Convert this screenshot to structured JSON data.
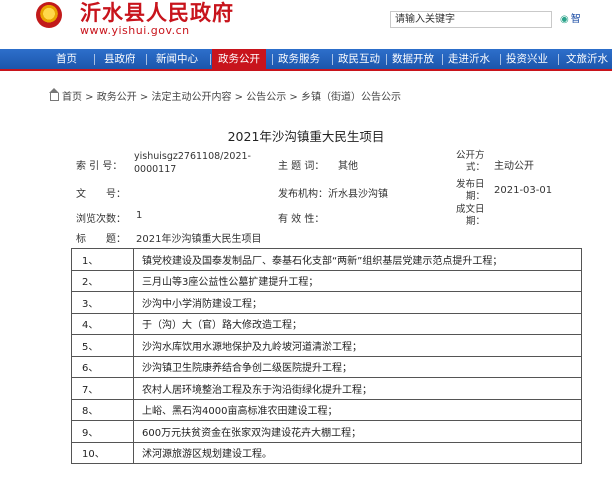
{
  "header": {
    "site_title": "沂水县人民政府",
    "site_url": "www.yishui.gov.cn",
    "search_placeholder": "请输入关键字",
    "search_button": "智"
  },
  "nav": {
    "items": [
      {
        "label": "首页",
        "active": false
      },
      {
        "label": "县政府",
        "active": false
      },
      {
        "label": "新闻中心",
        "active": false
      },
      {
        "label": "政务公开",
        "active": true
      },
      {
        "label": "政务服务",
        "active": false
      },
      {
        "label": "政民互动",
        "active": false
      },
      {
        "label": "数据开放",
        "active": false
      },
      {
        "label": "走进沂水",
        "active": false
      },
      {
        "label": "投资兴业",
        "active": false
      },
      {
        "label": "文旅沂水",
        "active": false
      }
    ]
  },
  "breadcrumb": {
    "text": "首页 > 政务公开 > 法定主动公开内容 > 公告公示 > 乡镇（街道）公告公示"
  },
  "article": {
    "title": "2021年沙沟镇重大民生项目"
  },
  "meta": {
    "index_label": "索 引 号：",
    "index_value_1": "yishuisgz2761108/2021-",
    "index_value_2": "0000117",
    "subject_label": "主 题 词：",
    "subject_value": "其他",
    "public_label_1": "公开方",
    "public_label_2": "式：",
    "public_value": "主动公开",
    "doc_label": "文　　号：",
    "publisher_label": "发布机构：",
    "publisher_value": "沂水县沙沟镇",
    "date_label_1": "发布日",
    "date_label_2": "期：",
    "date_value": "2021-03-01",
    "views_label": "浏览次数：",
    "views_value": "1",
    "validity_label": "有 效 性：",
    "validity_value": "",
    "created_label_1": "成文日",
    "created_label_2": "期：",
    "heading_label": "标　　题：",
    "heading_value": "2021年沙沟镇重大民生项目"
  },
  "projects": [
    {
      "num": "1、",
      "text": "镇党校建设及国泰发制品厂、泰基石化支部“两新”组织基层党建示范点提升工程；"
    },
    {
      "num": "2、",
      "text": "三月山等3座公益性公墓扩建提升工程；"
    },
    {
      "num": "3、",
      "text": "沙沟中小学消防建设工程；"
    },
    {
      "num": "4、",
      "text": "于（沟）大（官）路大修改造工程；"
    },
    {
      "num": "5、",
      "text": "沙沟水库饮用水源地保护及九岭坡河道清淤工程；"
    },
    {
      "num": "6、",
      "text": "沙沟镇卫生院康养结合争创二级医院提升工程；"
    },
    {
      "num": "7、",
      "text": "农村人居环境整治工程及东于沟沿街绿化提升工程；"
    },
    {
      "num": "8、",
      "text": "上峪、黑石沟4000亩高标准农田建设工程；"
    },
    {
      "num": "9、",
      "text": "600万元扶贫资金在张家双沟建设花卉大棚工程；"
    },
    {
      "num": "10、",
      "text": "沭河源旅游区规划建设工程。"
    }
  ]
}
